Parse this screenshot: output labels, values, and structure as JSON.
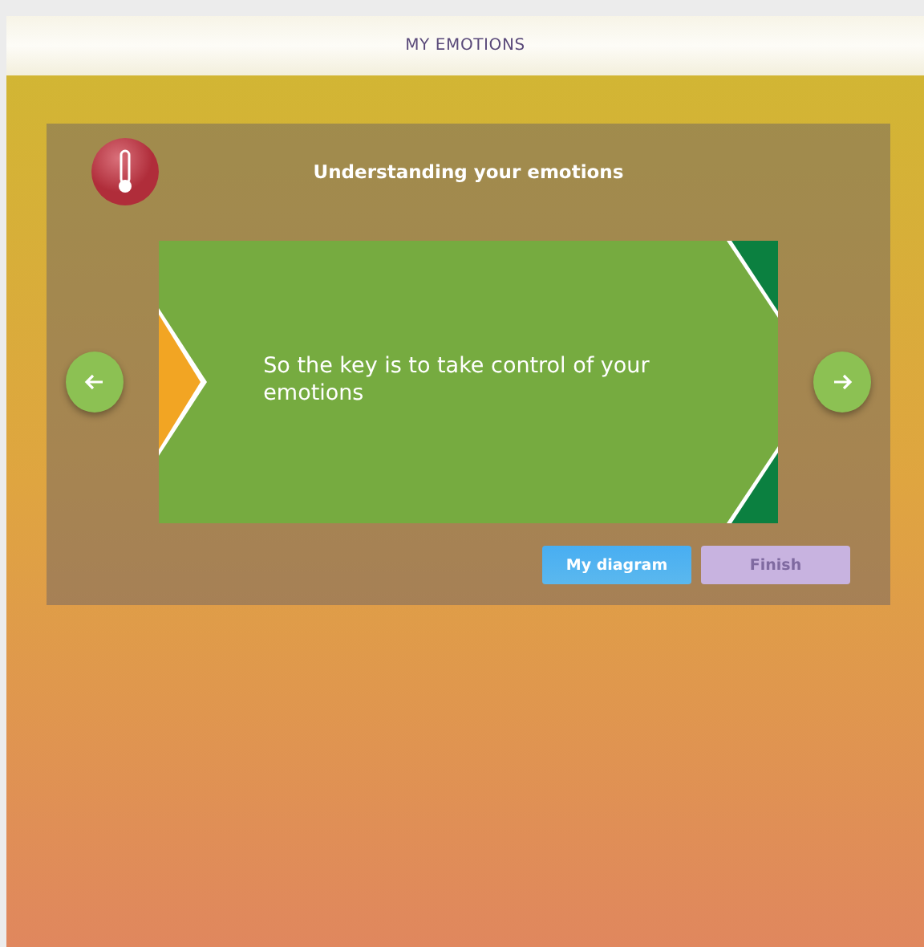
{
  "header": {
    "title": "MY EMOTIONS"
  },
  "panel": {
    "title": "Understanding your emotions",
    "slide": {
      "text": "So the key is to take control of your emotions"
    },
    "buttons": [
      {
        "label": "My diagram",
        "disabled": false
      },
      {
        "label": "Finish",
        "disabled": true
      }
    ]
  }
}
